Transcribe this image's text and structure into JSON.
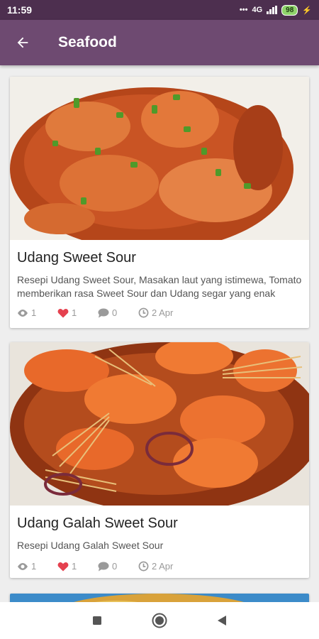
{
  "status_bar": {
    "time": "11:59",
    "network": "4G",
    "battery": "98",
    "icons": [
      "dots-icon",
      "signal-icon",
      "battery-icon",
      "charging-icon"
    ]
  },
  "app_bar": {
    "title": "Seafood",
    "back_icon": "arrow-left-icon",
    "background_color": "#6e4a71"
  },
  "recipes": [
    {
      "name": "Udang Sweet Sour",
      "description": "Resepi Udang Sweet Sour, Masakan laut yang istimewa, Tomato memberikan rasa Sweet Sour dan Udang segar yang enak",
      "views": "1",
      "likes": "1",
      "comments": "0",
      "date": "2 Apr"
    },
    {
      "name": "Udang Galah Sweet Sour",
      "description": "Resepi Udang Galah Sweet Sour",
      "views": "1",
      "likes": "1",
      "comments": "0",
      "date": "2 Apr"
    }
  ],
  "nav_bar": {
    "icons": [
      "square-icon",
      "home-circle-icon",
      "back-triangle-icon"
    ]
  },
  "colors": {
    "accent": "#6e4a71",
    "status_bar": "#4d2f4f",
    "like": "#e5414f"
  }
}
